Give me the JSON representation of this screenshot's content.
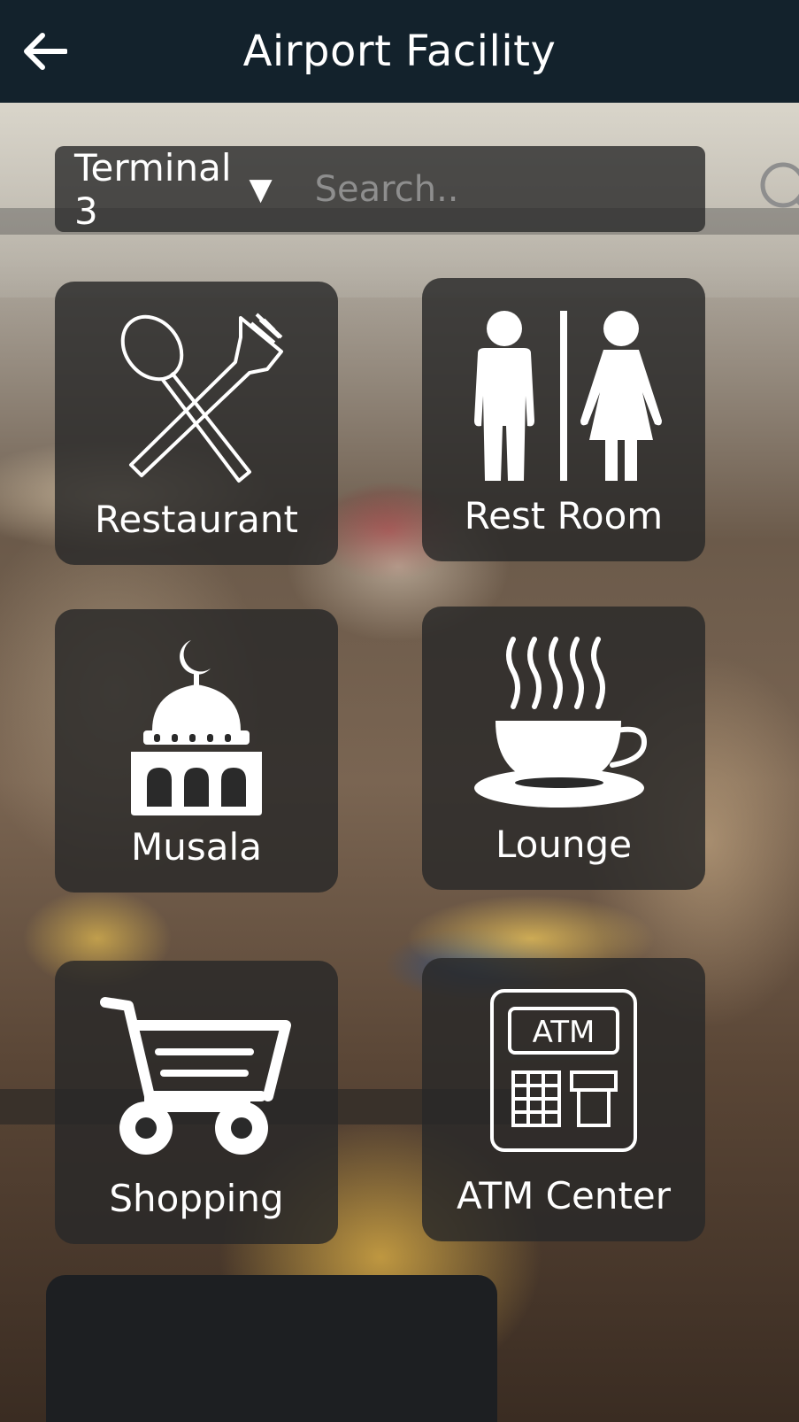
{
  "header": {
    "title": "Airport Facility",
    "back_icon": "arrow-left-icon"
  },
  "search": {
    "terminal_selected": "Terminal 3",
    "caret": "▼",
    "placeholder": "Search..",
    "search_icon": "search-icon"
  },
  "tiles": [
    {
      "label": "Restaurant",
      "icon": "fork-spoon-icon"
    },
    {
      "label": "Rest Room",
      "icon": "restroom-icon"
    },
    {
      "label": "Musala",
      "icon": "mosque-icon"
    },
    {
      "label": "Lounge",
      "icon": "coffee-cup-icon"
    },
    {
      "label": "Shopping",
      "icon": "shopping-cart-icon"
    },
    {
      "label": "ATM Center",
      "icon": "atm-icon",
      "icon_text": "ATM"
    }
  ],
  "colors": {
    "header_bg": "#13222c",
    "tile_bg": "rgba(40,40,40,0.82)",
    "text": "#ffffff",
    "placeholder": "#8e8e8e"
  }
}
